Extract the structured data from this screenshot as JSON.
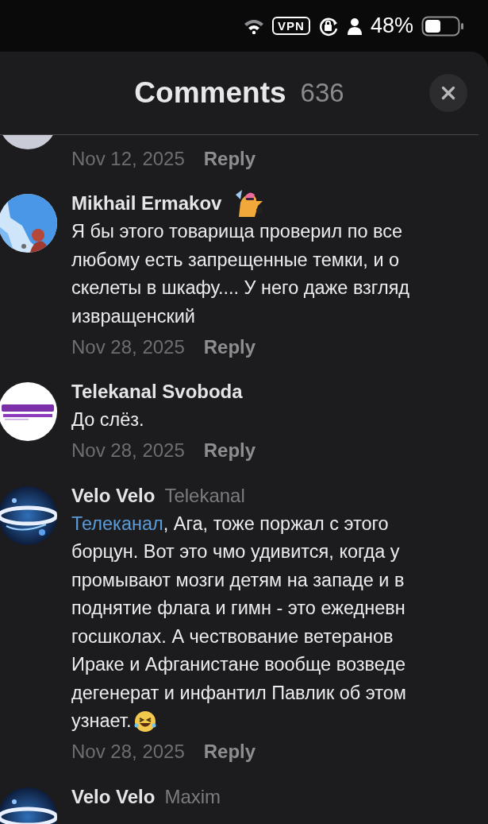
{
  "status_bar": {
    "vpn": "VPN",
    "battery": "48%"
  },
  "header": {
    "title": "Comments",
    "count": "636"
  },
  "comments": [
    {
      "kind": "partial",
      "date": "Nov 12, 2025",
      "reply": "Reply"
    },
    {
      "kind": "full",
      "author": "Mikhail Ermakov",
      "sticker": true,
      "lines": [
        "Я бы этого товарища проверил по все",
        "любому есть запрещенные темки, и о",
        "скелеты в шкафу.... У него даже взгляд",
        "извращенский"
      ],
      "date": "Nov 28, 2025",
      "reply": "Reply"
    },
    {
      "kind": "full",
      "author": "Telekanal Svoboda",
      "lines": [
        "До слёз."
      ],
      "date": "Nov 28, 2025",
      "reply": "Reply"
    },
    {
      "kind": "full",
      "author": "Velo Velo",
      "reply_to": "Telekanal",
      "mention": "Телеканал",
      "emoji_end": true,
      "lines": [
        ", Ага, тоже поржал с этого",
        "борцун. Вот это чмо удивится, когда у",
        "промывают мозги детям на западе и в",
        "поднятие флага и гимн - это ежедневн",
        "госшколах. А чествование ветеранов",
        "Ираке и Афганистане вообще возведе",
        "дегенерат и инфантил Павлик об этом",
        "узнает."
      ],
      "date": "Nov 28, 2025",
      "reply": "Reply"
    },
    {
      "kind": "cut",
      "author": "Velo Velo",
      "reply_to": "Maxim"
    }
  ]
}
